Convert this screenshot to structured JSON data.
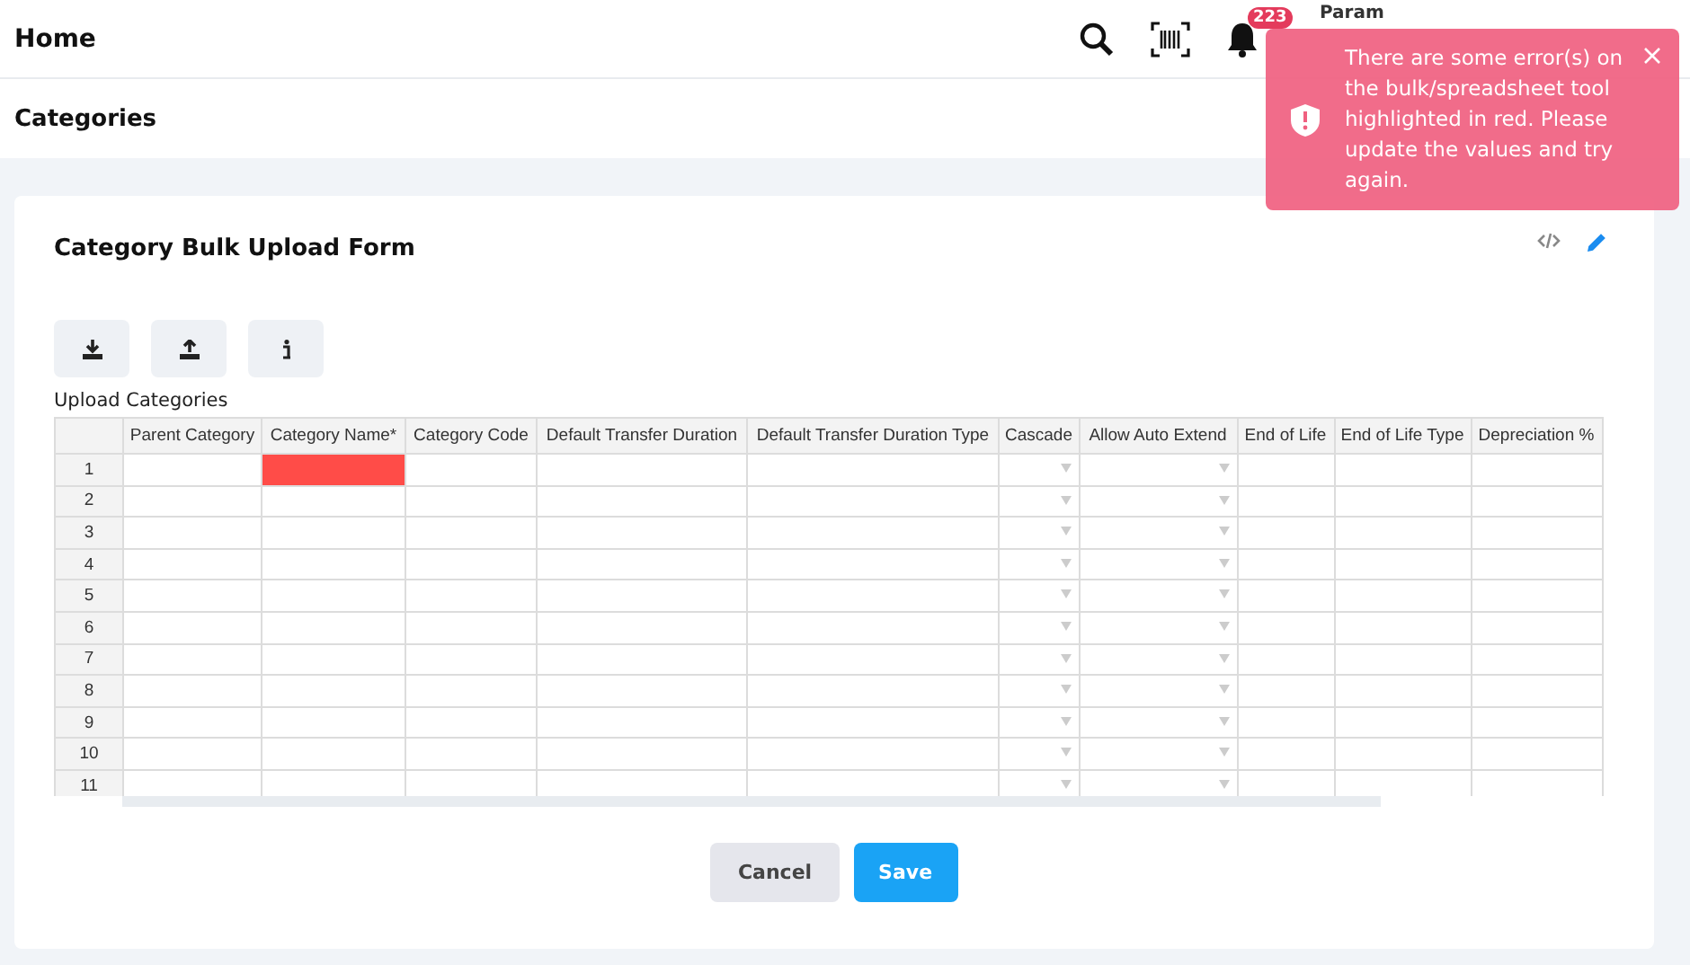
{
  "header": {
    "title": "Home",
    "notification_count": "223",
    "user": {
      "name": "Param"
    }
  },
  "breadcrumb": {
    "title": "Categories"
  },
  "toast": {
    "kind": "error",
    "message": "There are some error(s) on the bulk/spreadsheet tool highlighted in red. Please update the values and try again."
  },
  "card": {
    "title": "Category Bulk Upload Form",
    "upload_label": "Upload Categories",
    "columns": [
      {
        "label": "Parent Category",
        "kind": "text"
      },
      {
        "label": "Category Name*",
        "kind": "text"
      },
      {
        "label": "Category Code",
        "kind": "text"
      },
      {
        "label": "Default Transfer Duration",
        "kind": "text"
      },
      {
        "label": "Default Transfer Duration Type",
        "kind": "text"
      },
      {
        "label": "Cascade",
        "kind": "dropdown"
      },
      {
        "label": "Allow Auto Extend",
        "kind": "dropdown"
      },
      {
        "label": "End of Life",
        "kind": "text"
      },
      {
        "label": "End of Life Type",
        "kind": "text"
      },
      {
        "label": "Depreciation %",
        "kind": "text"
      }
    ],
    "rows": [
      {
        "number": "1",
        "invalid": [
          false,
          true,
          false,
          false,
          false,
          false,
          false,
          false,
          false,
          false
        ]
      },
      {
        "number": "2",
        "invalid": [
          false,
          false,
          false,
          false,
          false,
          false,
          false,
          false,
          false,
          false
        ]
      },
      {
        "number": "3",
        "invalid": [
          false,
          false,
          false,
          false,
          false,
          false,
          false,
          false,
          false,
          false
        ]
      },
      {
        "number": "4",
        "invalid": [
          false,
          false,
          false,
          false,
          false,
          false,
          false,
          false,
          false,
          false
        ]
      },
      {
        "number": "5",
        "invalid": [
          false,
          false,
          false,
          false,
          false,
          false,
          false,
          false,
          false,
          false
        ]
      },
      {
        "number": "6",
        "invalid": [
          false,
          false,
          false,
          false,
          false,
          false,
          false,
          false,
          false,
          false
        ]
      },
      {
        "number": "7",
        "invalid": [
          false,
          false,
          false,
          false,
          false,
          false,
          false,
          false,
          false,
          false
        ]
      },
      {
        "number": "8",
        "invalid": [
          false,
          false,
          false,
          false,
          false,
          false,
          false,
          false,
          false,
          false
        ]
      },
      {
        "number": "9",
        "invalid": [
          false,
          false,
          false,
          false,
          false,
          false,
          false,
          false,
          false,
          false
        ]
      },
      {
        "number": "10",
        "invalid": [
          false,
          false,
          false,
          false,
          false,
          false,
          false,
          false,
          false,
          false
        ]
      },
      {
        "number": "11",
        "invalid": [
          false,
          false,
          false,
          false,
          false,
          false,
          false,
          false,
          false,
          false
        ]
      }
    ],
    "buttons": [
      {
        "label": "Cancel",
        "kind": "secondary"
      },
      {
        "label": "Save",
        "kind": "primary"
      }
    ]
  }
}
